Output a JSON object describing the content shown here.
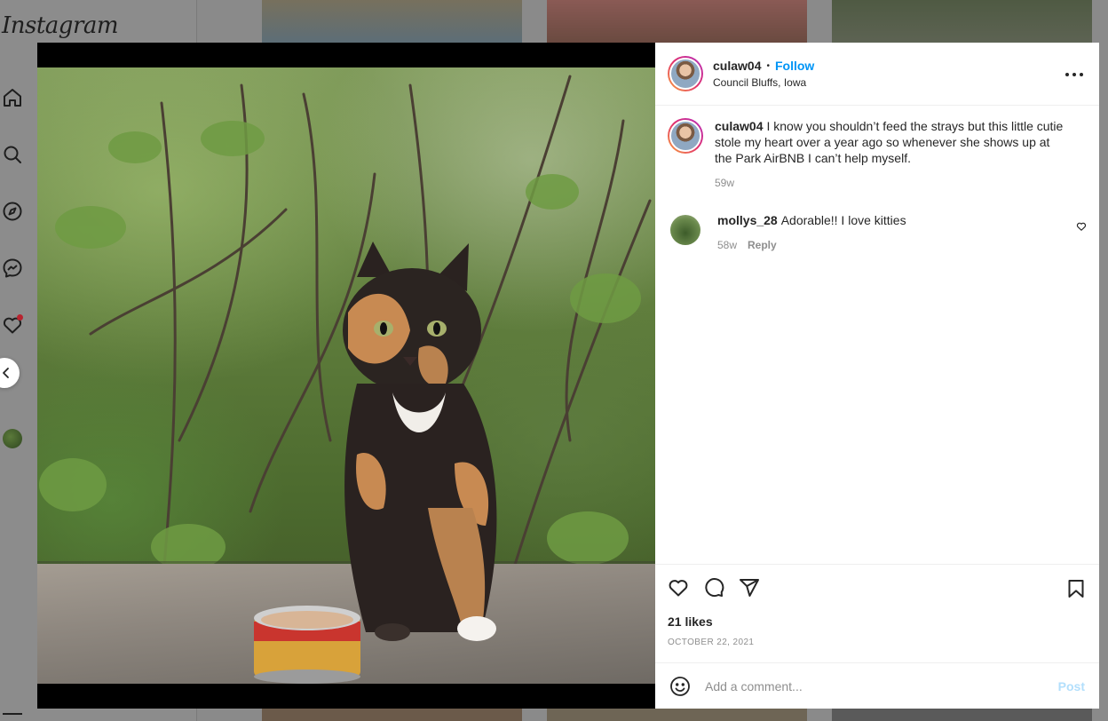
{
  "app": {
    "logo_text": "Instagram"
  },
  "sidebar": {
    "items": [
      {
        "icon": "home-icon"
      },
      {
        "icon": "search-icon"
      },
      {
        "icon": "explore-icon"
      },
      {
        "icon": "messenger-icon"
      },
      {
        "icon": "heart-icon",
        "has_notification": true
      },
      {
        "icon": "create-icon"
      },
      {
        "icon": "profile-avatar"
      }
    ]
  },
  "post": {
    "author": {
      "username": "culaw04",
      "follow_label": "Follow",
      "location": "Council Bluffs, Iowa"
    },
    "caption": {
      "username": "culaw04",
      "text": "I know you shouldn’t feed the strays but this little cutie stole my heart over a year ago so whenever she shows up at the Park AirBNB I can’t help myself.",
      "age": "59w"
    },
    "comments": [
      {
        "username": "mollys_28",
        "text": "Adorable!! I love kitties",
        "age": "58w",
        "reply_label": "Reply"
      }
    ],
    "likes": "21 likes",
    "date": "OCTOBER 22, 2021",
    "add_comment": {
      "placeholder": "Add a comment...",
      "post_label": "Post"
    }
  },
  "colors": {
    "accent": "#0095f6",
    "post_disabled": "#b2dffc",
    "muted_text": "#8e8e8e",
    "text": "#262626"
  }
}
